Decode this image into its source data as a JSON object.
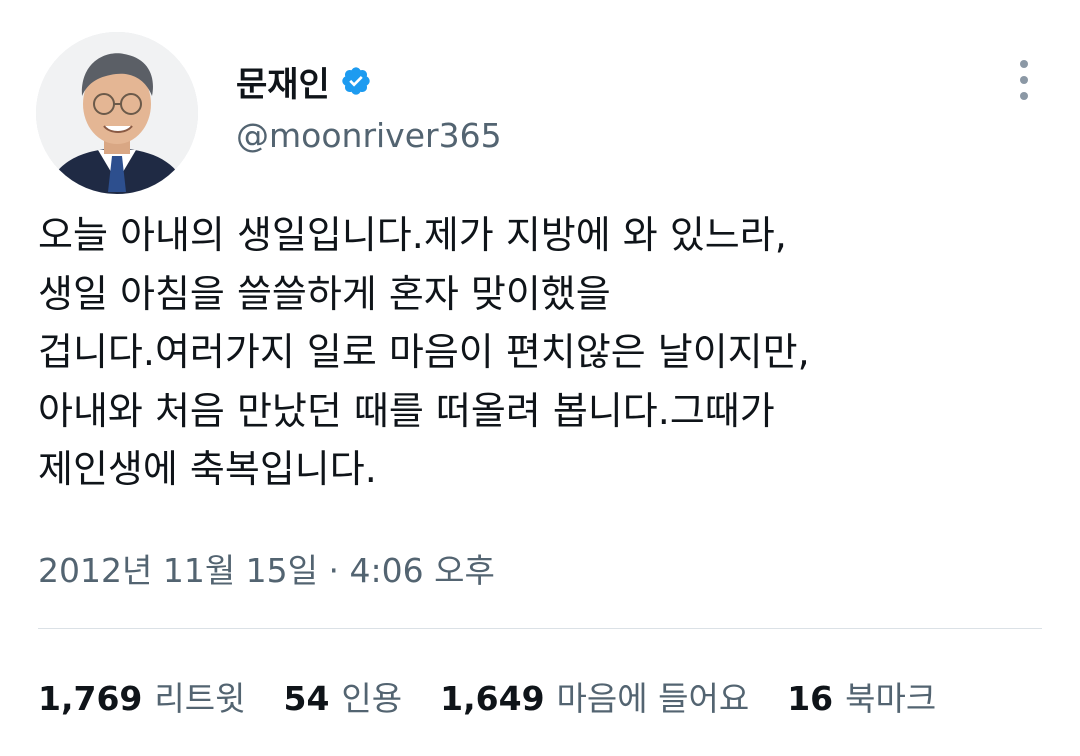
{
  "author": {
    "display_name": "문재인",
    "handle": "@moonriver365",
    "verified": true
  },
  "tweet": {
    "text": "오늘 아내의 생일입니다.제가 지방에 와 있느라,\n생일 아침을 쓸쓸하게 혼자 맞이했을\n겁니다.여러가지 일로 마음이 편치않은 날이지만,\n아내와 처음 만났던 때를 떠올려 봅니다.그때가\n제인생에 축복입니다.",
    "timestamp": "2012년 11월 15일 · 4:06 오후"
  },
  "stats": [
    {
      "count": "1,769",
      "label": "리트윗"
    },
    {
      "count": "54",
      "label": "인용"
    },
    {
      "count": "1,649",
      "label": "마음에 들어요"
    },
    {
      "count": "16",
      "label": "북마크"
    }
  ],
  "colors": {
    "verified_badge": "#1d9bf0",
    "secondary_text": "#536471",
    "primary_text": "#0f1419",
    "divider": "#dbe1e6"
  }
}
